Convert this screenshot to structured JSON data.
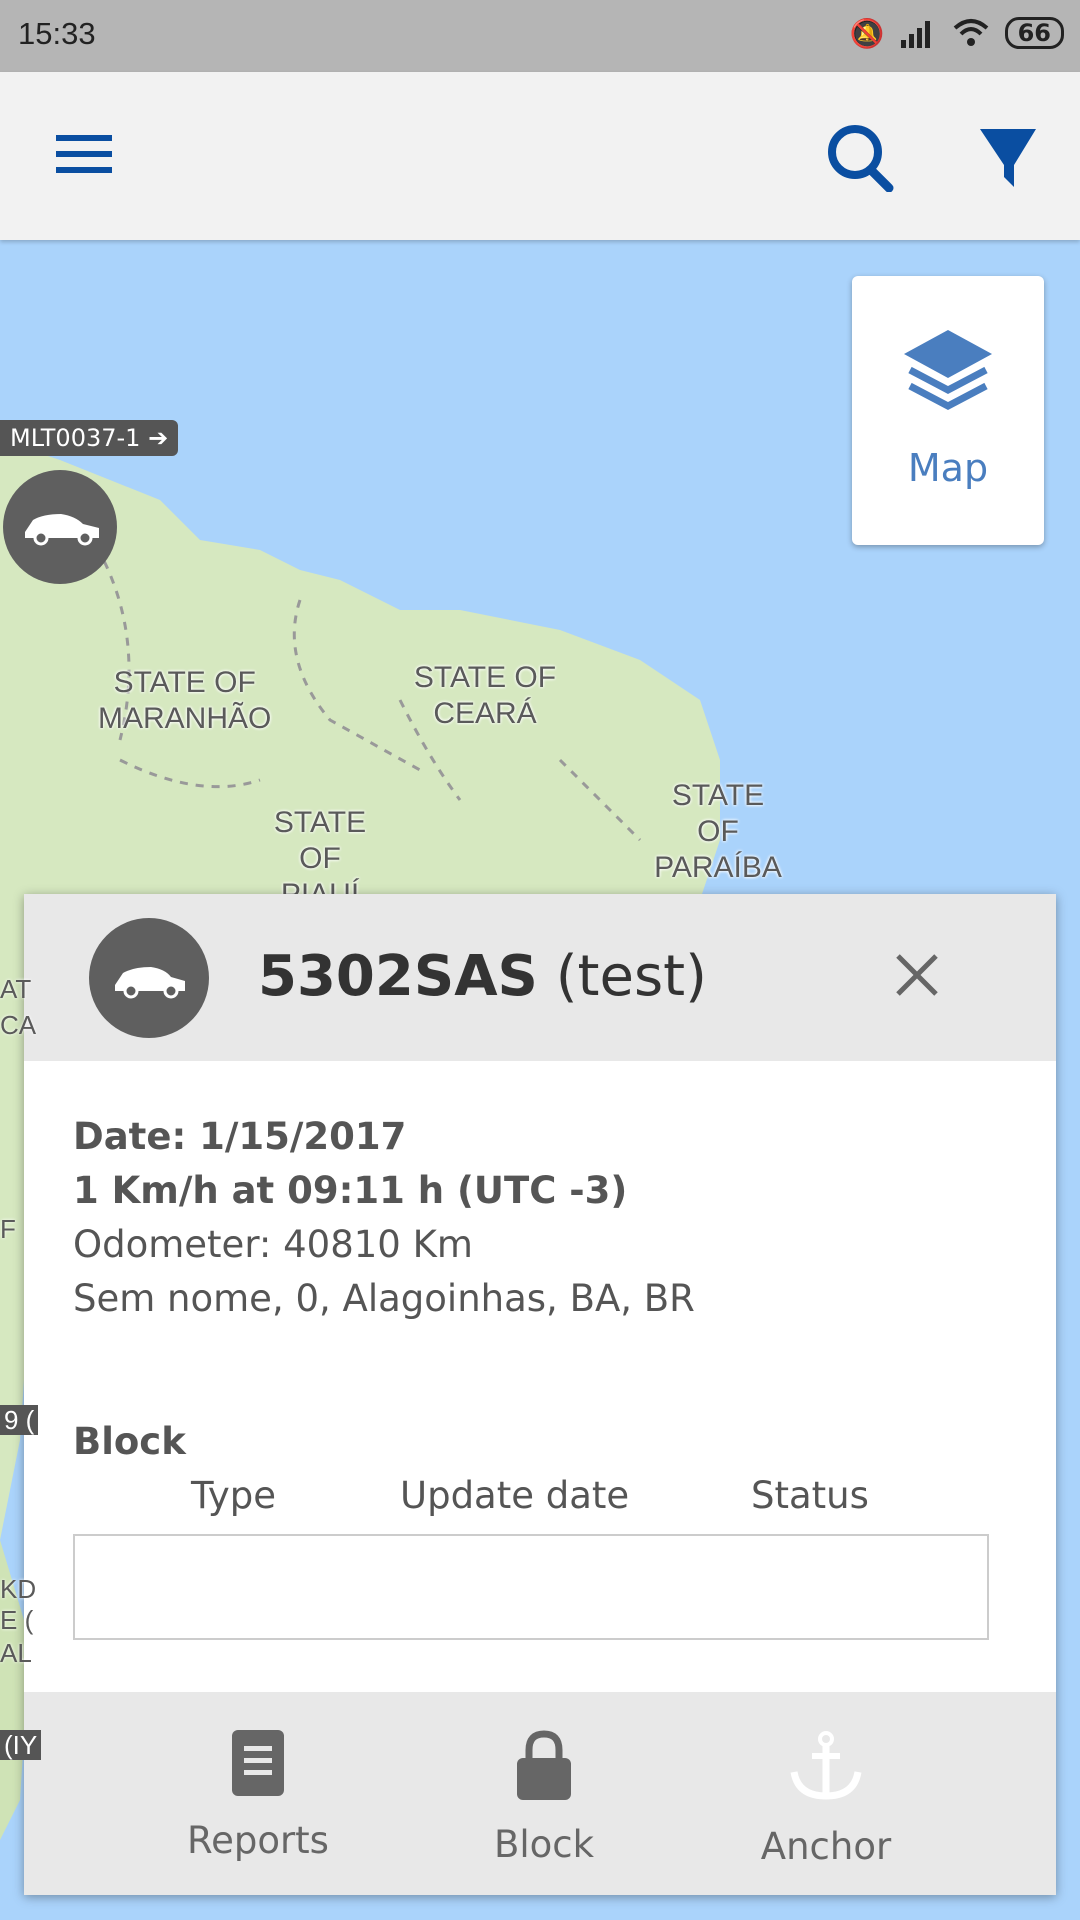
{
  "status_bar": {
    "time": "15:33",
    "battery": "66"
  },
  "toolbar": {
    "menu_icon": "hamburger-icon",
    "search_icon": "search-icon",
    "filter_icon": "filter-icon",
    "accent": "#0a4ea1"
  },
  "map": {
    "layer_button_label": "Map",
    "vehicle_tag": "MLT0037-1",
    "labels": [
      "STATE OF MARANHÃO",
      "STATE OF CEARÁ",
      "STATE OF PIAUÍ",
      "STATE OF PARAÍBA"
    ],
    "partial_labels": [
      "AT",
      "CA",
      "F",
      "9 (",
      "KD",
      "E (",
      "AL",
      "(IY"
    ]
  },
  "panel": {
    "plate": "5302SAS",
    "name": "(test)",
    "date": "Date: 1/15/2017",
    "speed": "1 Km/h at 09:11 h (UTC -3)",
    "odometer": "Odometer: 40810 Km",
    "address": "Sem nome, 0, Alagoinhas, BA, BR",
    "block_heading": "Block",
    "columns": [
      "Type",
      "Update date",
      "Status"
    ],
    "footer": [
      {
        "label": "Reports",
        "icon": "report-icon"
      },
      {
        "label": "Block",
        "icon": "lock-icon"
      },
      {
        "label": "Anchor",
        "icon": "anchor-icon"
      }
    ]
  }
}
